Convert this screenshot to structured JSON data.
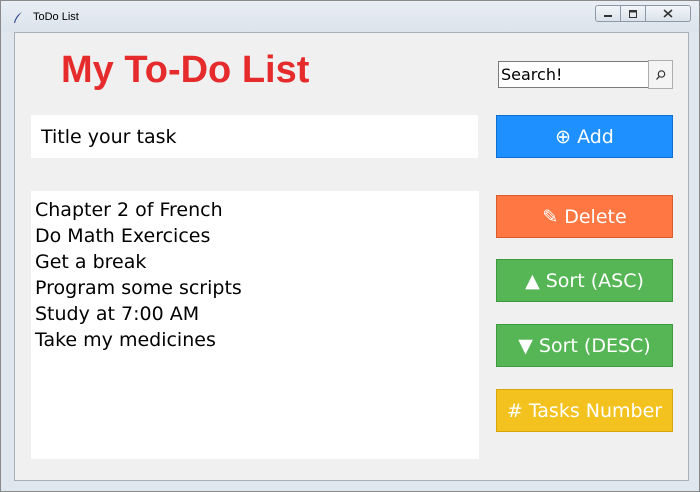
{
  "window": {
    "title": "ToDo List",
    "controls": [
      "minimize",
      "maximize",
      "close"
    ]
  },
  "header": {
    "heading": "My To-Do List"
  },
  "search": {
    "value": "Search!",
    "button_icon": "search-icon"
  },
  "task_input": {
    "value": "Title your task"
  },
  "buttons": {
    "add": {
      "icon": "⊕",
      "label": "Add"
    },
    "delete": {
      "icon": "✎",
      "label": "Delete"
    },
    "sort_asc": {
      "icon": "▲",
      "label": "Sort (ASC)"
    },
    "sort_desc": {
      "icon": "▼",
      "label": "Sort (DESC)"
    },
    "tasks_number": {
      "icon": "#",
      "label": "Tasks Number"
    }
  },
  "tasks": [
    "Chapter 2 of French",
    "Do Math Exercices",
    "Get a break",
    "Program some scripts",
    "Study at 7:00 AM",
    "Take my medicines"
  ],
  "colors": {
    "heading": "#e52b2b",
    "add": "#1e90ff",
    "delete": "#ff7844",
    "sort": "#56b656",
    "tasks_number": "#f4c21f"
  }
}
